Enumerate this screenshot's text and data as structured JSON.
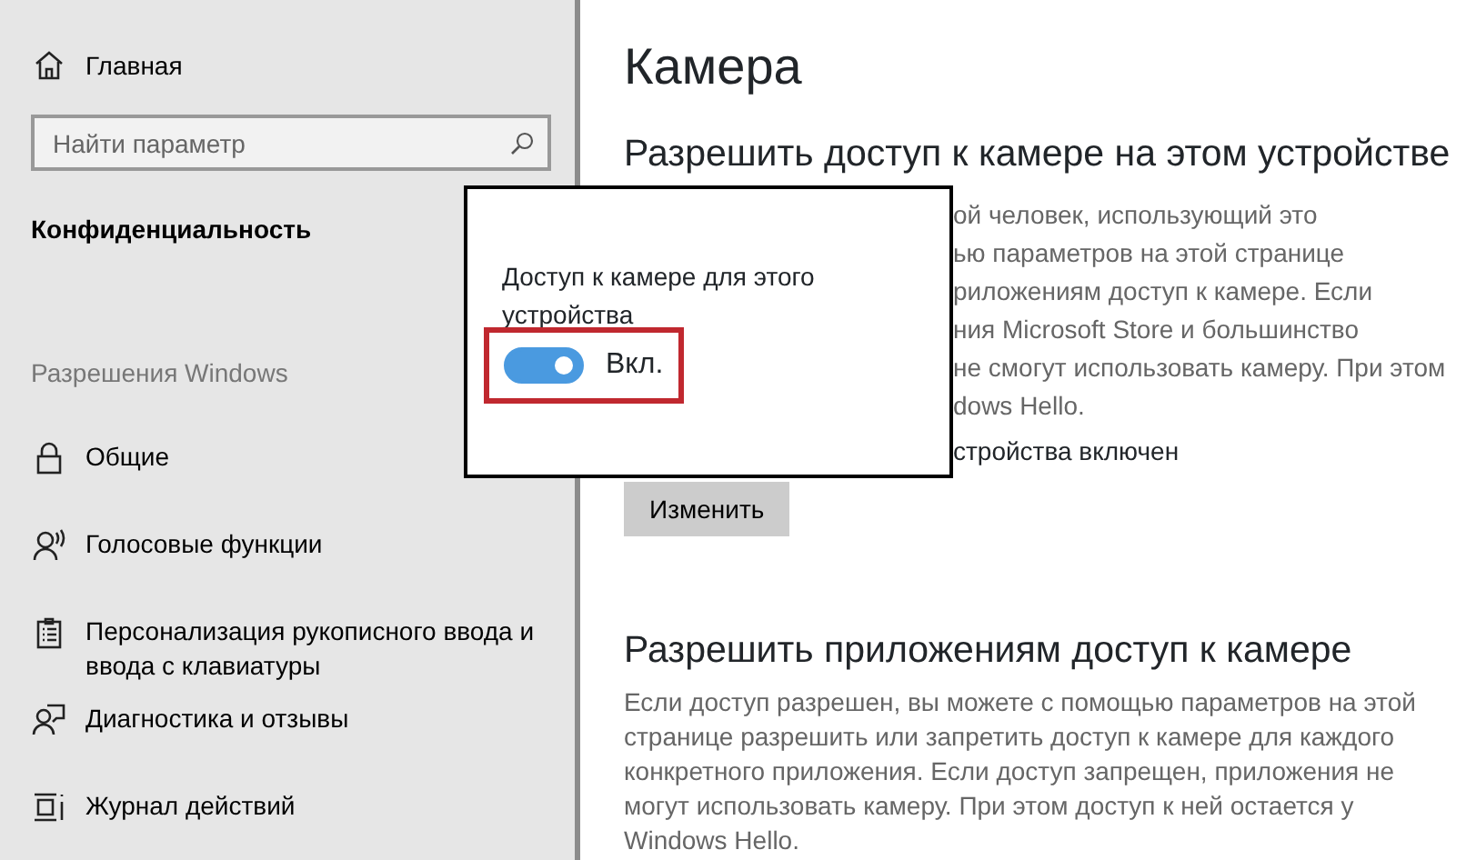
{
  "sidebar": {
    "home": {
      "label": "Главная"
    },
    "search": {
      "placeholder": "Найти параметр"
    },
    "section_title": "Конфиденциальность",
    "group_title": "Разрешения Windows",
    "items": [
      {
        "label": "Общие"
      },
      {
        "label": "Голосовые функции"
      },
      {
        "label": "Персонализация рукописного ввода и ввода с клавиатуры"
      },
      {
        "label": "Диагностика и отзывы"
      },
      {
        "label": "Журнал действий"
      }
    ]
  },
  "page": {
    "title": "Камера",
    "device_section": {
      "heading": "Разрешить доступ к камере на этом устройстве",
      "paragraph_lines": [
        "ой человек, использующий это",
        "ью параметров на этой странице",
        "риложениям доступ к камере. Если",
        "ния Microsoft Store и большинство",
        "не смогут использовать камеру. При этом",
        "dows Hello."
      ],
      "status": "стройства включен",
      "button": "Изменить"
    },
    "apps_section": {
      "heading": "Разрешить приложениям доступ к камере",
      "paragraph": "Если доступ разрешен, вы можете с помощью параметров на этой странице разрешить или запретить доступ к камере для каждого конкретного приложения. Если доступ запрещен, приложения не могут использовать камеру. При этом доступ к ней остается у Windows Hello."
    }
  },
  "popup": {
    "label": "Доступ к камере для этого устройства",
    "toggle": {
      "on": true,
      "label": "Вкл.",
      "highlighted": true
    }
  }
}
